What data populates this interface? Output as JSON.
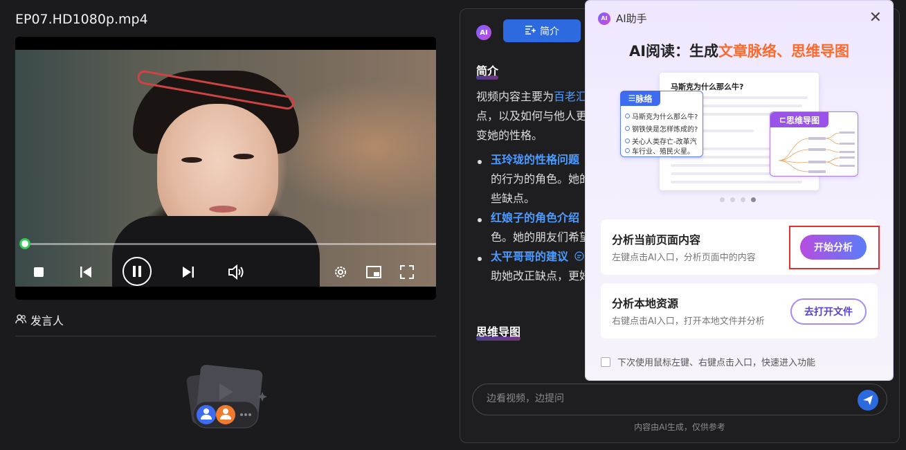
{
  "video": {
    "title": "EP07.HD1080p.mp4",
    "progress": 0.02
  },
  "speaker": {
    "label": "发言人"
  },
  "right_panel": {
    "tab_label": "简介",
    "ai_badge": "AI",
    "intro_heading": "简介",
    "intro_text_1_prefix": "视频内容主要为",
    "intro_text_1_link": "百老汇",
    "intro_text_2": "点，以及如何与他人更",
    "intro_text_3": "变她的性格。",
    "bullets": [
      {
        "title": "玉玲珑的性格问题",
        "line2": "的行为的角色。她的",
        "line3": "些缺点。"
      },
      {
        "title": "红娘子的角色介绍",
        "line2": "色。她的朋友们希望"
      },
      {
        "title": "太平哥哥的建议",
        "line2": "助她改正缺点，更好"
      }
    ],
    "mindmap_heading": "思维导图",
    "ask_placeholder": "边看视频，边提问",
    "footnote": "内容由AI生成，仅供参考"
  },
  "popup": {
    "logo": "AI",
    "title": "AI助手",
    "headline_prefix": "AI阅读：生成",
    "headline_accent": "文章脉络、思维导图",
    "preview": {
      "doc_title": "马斯克为什么那么牛?",
      "outline_label": "脉络",
      "outline_items": [
        "马斯克为什么那么牛?",
        "钢铁侠是怎样炼成的?",
        "关心人类存亡-改革汽",
        "车行业、殖民火星。"
      ],
      "mindmap_label": "思维导图"
    },
    "card1": {
      "title": "分析当前页面内容",
      "subtitle": "左键点击AI入口，分析页面中的内容",
      "button": "开始分析"
    },
    "card2": {
      "title": "分析本地资源",
      "subtitle": "右键点击AI入口，打开本地文件并分析",
      "button": "去打开文件"
    },
    "checkbox_label": "下次使用鼠标左键、右键点击入口，快速进入功能"
  },
  "colors": {
    "accent_blue": "#2d6ae0",
    "link_blue": "#4e9bff",
    "headline_orange": "#ff6a2a",
    "progress_green": "#34c759",
    "highlight_red": "#e03030"
  }
}
